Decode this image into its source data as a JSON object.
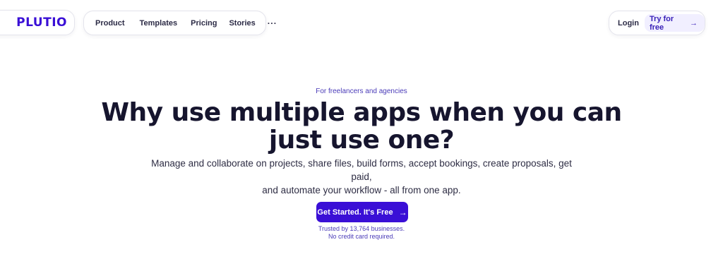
{
  "brand": {
    "logo": "PLUTIO",
    "accent": "#3a0fd6"
  },
  "nav": {
    "items": [
      "Product",
      "Templates",
      "Pricing",
      "Stories"
    ],
    "more": "···"
  },
  "auth": {
    "login": "Login",
    "try": "Try for free",
    "try_arrow": "→"
  },
  "hero": {
    "eyebrow": "For freelancers and agencies",
    "headline_1": "Why use multiple apps when you can",
    "headline_2": "just use one?",
    "sub_1": "Manage and collaborate on projects, share files, build forms, accept bookings, create proposals, get paid,",
    "sub_2": "and automate your workflow - all from one app.",
    "cta": "Get Started. It's Free",
    "cta_arrow": "→",
    "trust_1": "Trusted by 13,764 businesses.",
    "trust_2": "No credit card required."
  }
}
